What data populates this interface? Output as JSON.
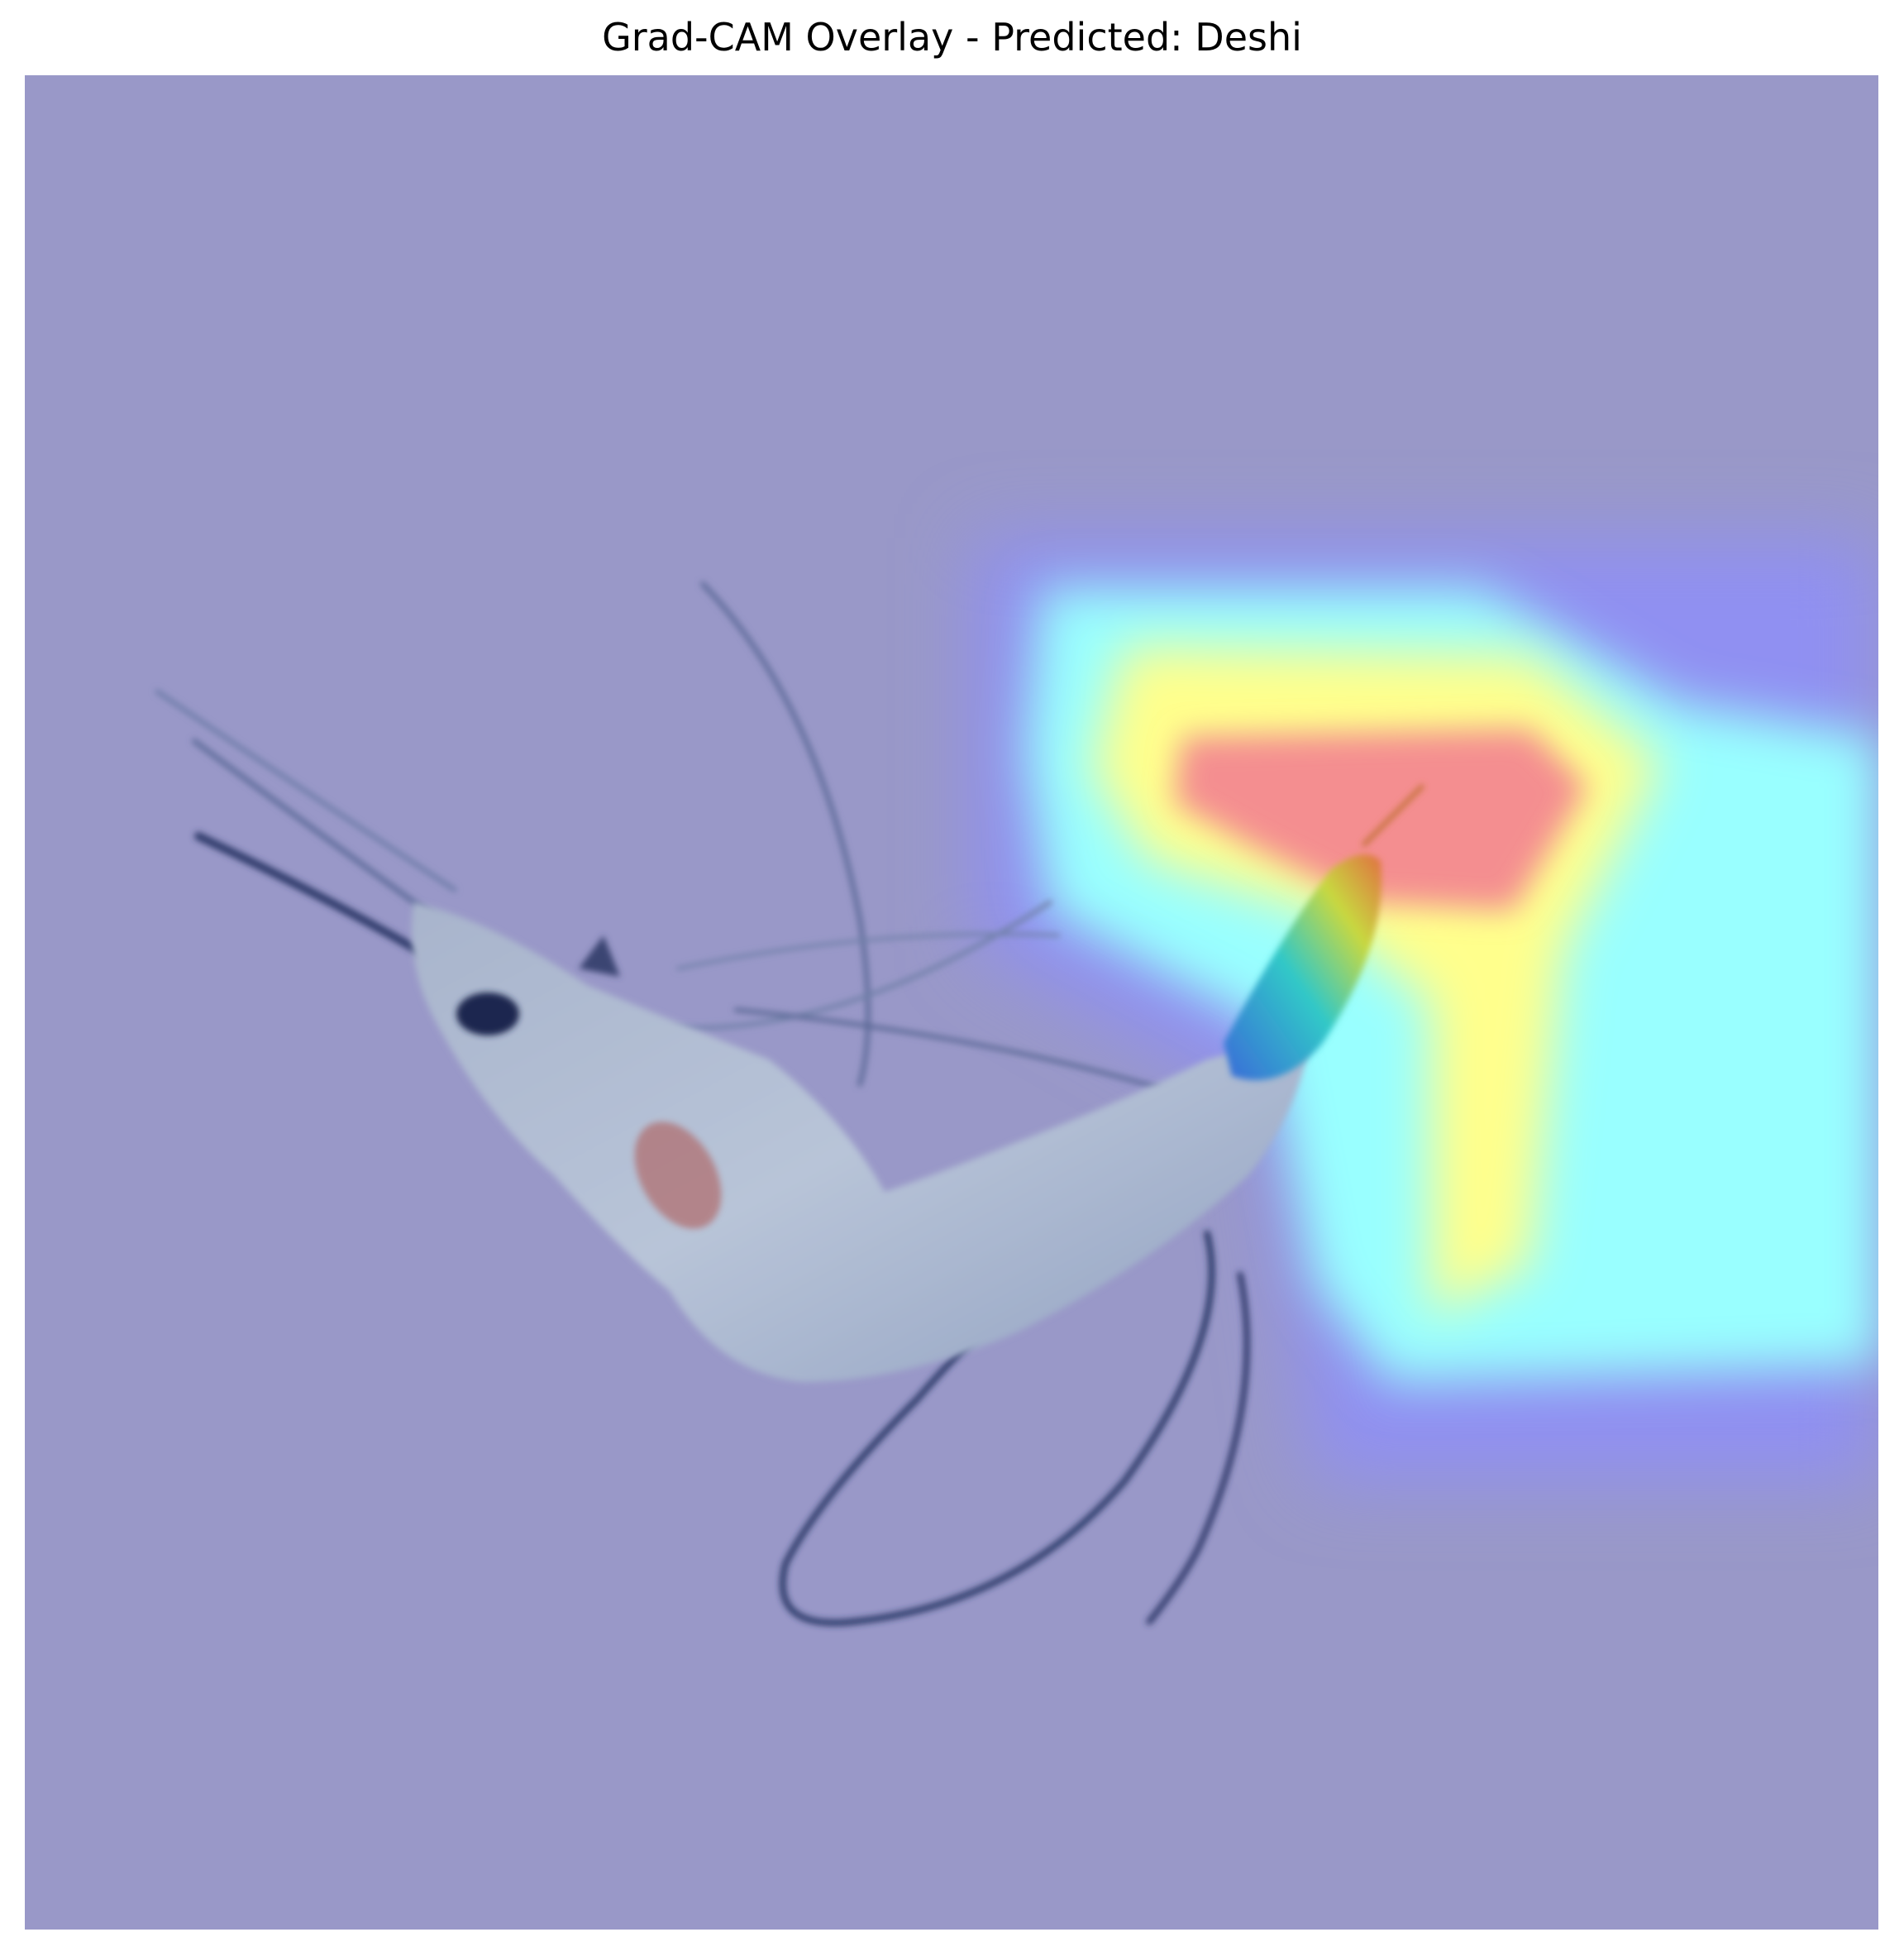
{
  "figure": {
    "title": "Grad-CAM Overlay - Predicted: Deshi"
  },
  "overlay": {
    "colors": {
      "background_tint": "#9998c8",
      "cold": "#9090f0",
      "cool": "#99ffff",
      "warm": "#ffff90",
      "hot": "#f89090"
    }
  }
}
